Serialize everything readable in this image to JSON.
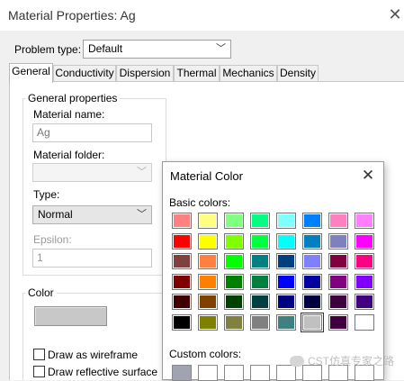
{
  "window": {
    "title": "Material Properties: Ag",
    "close_glyph": "✕"
  },
  "problem_type": {
    "label": "Problem type:",
    "value": "Default"
  },
  "tabs": [
    {
      "label": "General",
      "active": true
    },
    {
      "label": "Conductivity"
    },
    {
      "label": "Dispersion"
    },
    {
      "label": "Thermal"
    },
    {
      "label": "Mechanics"
    },
    {
      "label": "Density"
    }
  ],
  "general": {
    "group_title": "General properties",
    "name_label": "Material name:",
    "name_value": "Ag",
    "folder_label": "Material folder:",
    "folder_value": "",
    "type_label": "Type:",
    "type_value": "Normal",
    "epsilon_label": "Epsilon:",
    "epsilon_value": "1"
  },
  "color_group": {
    "title": "Color",
    "button_color": "#c8c8c8",
    "wireframe_label": "Draw as wireframe",
    "reflective_label": "Draw reflective surface"
  },
  "dialog": {
    "title": "Material Color",
    "close_glyph": "✕",
    "basic_label": "Basic colors:",
    "custom_label": "Custom colors:",
    "basic_colors": [
      [
        "#ff8080",
        "#ffff80",
        "#80ff80",
        "#00ff80",
        "#80ffff",
        "#0080ff",
        "#ff80c0",
        "#ff80ff"
      ],
      [
        "#ff0000",
        "#ffff00",
        "#80ff00",
        "#00ff40",
        "#00ffff",
        "#0080c0",
        "#8080c0",
        "#ff00ff"
      ],
      [
        "#804040",
        "#ff8040",
        "#00ff00",
        "#008080",
        "#004080",
        "#8080ff",
        "#800040",
        "#ff0080"
      ],
      [
        "#800000",
        "#ff8000",
        "#008000",
        "#008040",
        "#0000ff",
        "#0000a0",
        "#800080",
        "#8000ff"
      ],
      [
        "#400000",
        "#804000",
        "#004000",
        "#004040",
        "#000080",
        "#000040",
        "#400040",
        "#400080"
      ],
      [
        "#000000",
        "#808000",
        "#808040",
        "#808080",
        "#408080",
        "#c0c0c0",
        "#400040",
        "#ffffff"
      ]
    ],
    "selected": "#c0c0c0",
    "custom_colors": [
      "#a0a4b0",
      "#ffffff",
      "#ffffff",
      "#ffffff",
      "#ffffff",
      "#ffffff",
      "#ffffff",
      "#ffffff"
    ]
  },
  "watermark": {
    "text": "CST仿真专家之路"
  }
}
